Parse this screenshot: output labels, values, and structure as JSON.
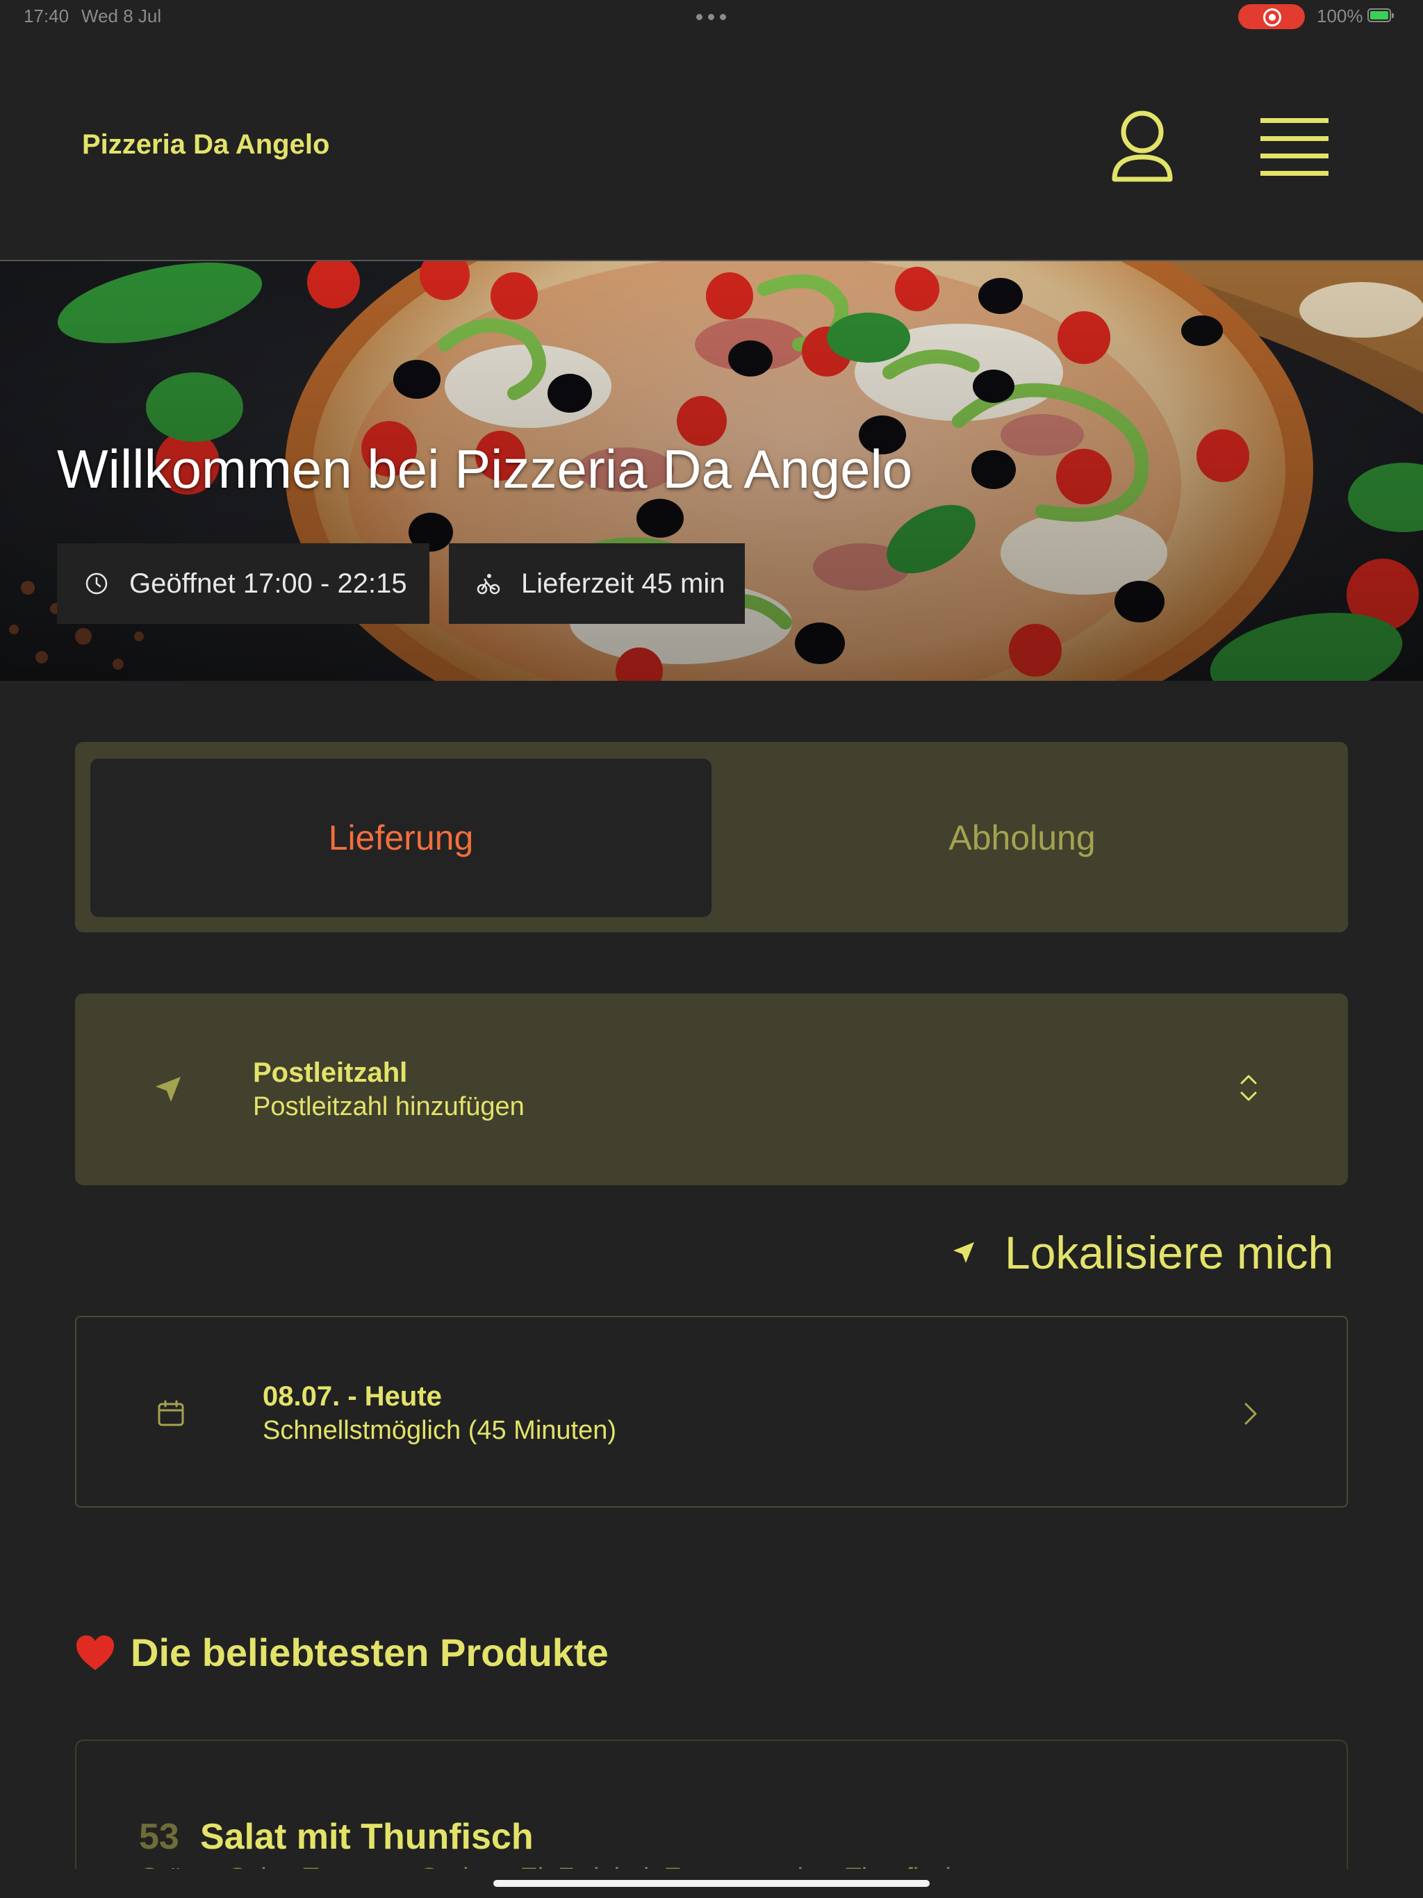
{
  "status_bar": {
    "time": "17:40",
    "date": "Wed 8 Jul",
    "battery": "100%"
  },
  "header": {
    "brand": "Pizzeria Da Angelo",
    "accent_color": "#e3e36a",
    "user_icon": "user-icon",
    "menu_icon": "hamburger-menu-icon"
  },
  "hero": {
    "title": "Willkommen bei Pizzeria Da Angelo",
    "opening_hours": "Geöffnet 17:00 - 22:15",
    "delivery_time": "Lieferzeit 45 min"
  },
  "order_mode": {
    "options": [
      "Lieferung",
      "Abholung"
    ],
    "selected": "Lieferung",
    "active_color": "#f26f3e"
  },
  "postcode": {
    "title": "Postleitzahl",
    "placeholder": "Postleitzahl hinzufügen"
  },
  "locate": {
    "label": "Lokalisiere mich"
  },
  "schedule": {
    "title": "08.07. - Heute",
    "subtitle": "Schnellstmöglich (45 Minuten)"
  },
  "popular": {
    "heading": "Die beliebtesten Produkte",
    "products": [
      {
        "number": "53",
        "name": "Salat mit Thunfisch",
        "description": "Grüner Salat, Tomaten, Gurken, Ei, Zwiebel, Essvorurtetlos, Thunfisch"
      }
    ]
  }
}
